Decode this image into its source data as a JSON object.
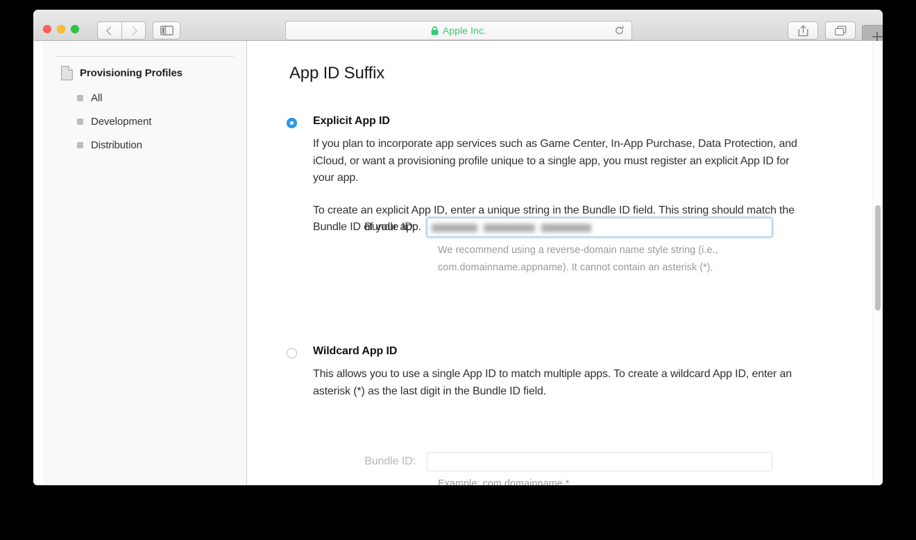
{
  "window": {
    "traffic_lights": [
      {
        "name": "close",
        "color": "#ff5f57"
      },
      {
        "name": "minimize",
        "color": "#febc2e"
      },
      {
        "name": "zoom",
        "color": "#28c840"
      }
    ]
  },
  "toolbar": {
    "back_icon": "chevron-left-icon",
    "forward_icon": "chevron-right-icon",
    "sidebar_toggle_icon": "sidebar-icon",
    "share_icon": "share-icon",
    "tabs_icon": "show-all-tabs-icon",
    "new_tab_label": "+",
    "address": {
      "lock_icon": "lock-icon",
      "text": "Apple Inc.",
      "secure_color": "#2ecc71",
      "reload_icon": "reload-icon"
    }
  },
  "sidebar": {
    "header": {
      "icon": "document-icon",
      "label": "Provisioning Profiles"
    },
    "items": [
      {
        "label": "All"
      },
      {
        "label": "Development"
      },
      {
        "label": "Distribution"
      }
    ]
  },
  "main": {
    "page_title": "App ID Suffix",
    "options": [
      {
        "id": "explicit",
        "label": "Explicit App ID",
        "selected": true,
        "paragraphs": [
          "If you plan to incorporate app services such as Game Center, In-App Purchase, Data Protection, and iCloud, or want a provisioning profile unique to a single app, you must register an explicit App ID for your app.",
          "To create an explicit App ID, enter a unique string in the Bundle ID field. This string should match the Bundle ID of your app."
        ],
        "field": {
          "label": "Bundle ID:",
          "value": "",
          "value_redacted": true,
          "placeholder": "",
          "focused": true,
          "disabled": false
        },
        "hint": "We recommend using a reverse-domain name style string (i.e., com.domainname.appname). It cannot contain an asterisk (*)."
      },
      {
        "id": "wildcard",
        "label": "Wildcard App ID",
        "selected": false,
        "paragraphs": [
          "This allows you to use a single App ID to match multiple apps. To create a wildcard App ID, enter an asterisk (*) as the last digit in the Bundle ID field."
        ],
        "field": {
          "label": "Bundle ID:",
          "value": "",
          "value_redacted": false,
          "placeholder": "",
          "focused": false,
          "disabled": true
        },
        "hint": "Example: com.domainname.*"
      }
    ]
  },
  "scrollbar": {
    "thumb_color": "#c0c0c0"
  },
  "colors": {
    "accent": "#2e9ded",
    "secure_green": "#2ecc71",
    "sidebar_bg": "#f8f9f8"
  }
}
